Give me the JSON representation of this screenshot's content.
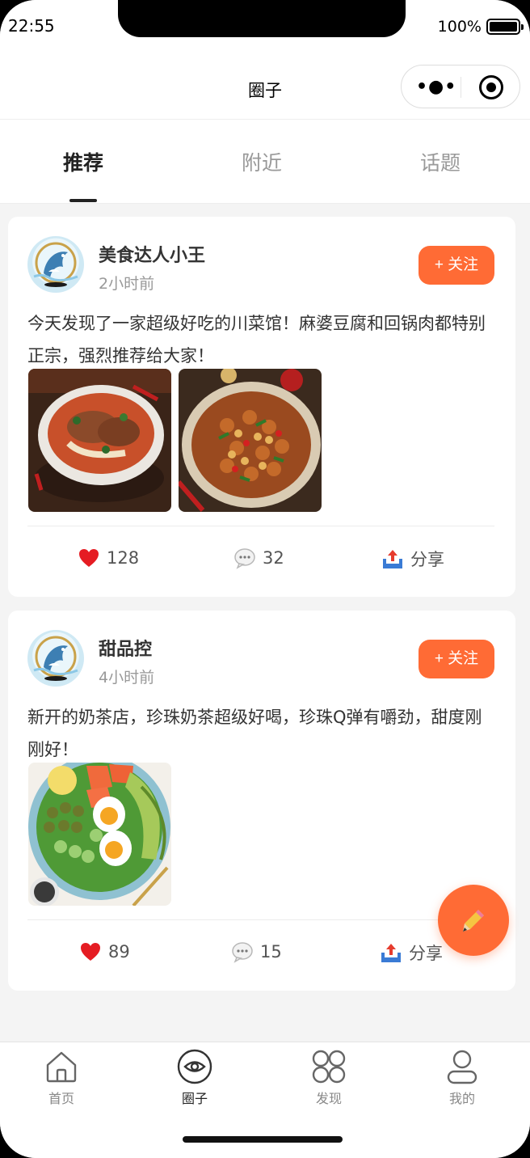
{
  "status_bar": {
    "time": "22:55",
    "battery": "100%",
    "battery_level": 1.0
  },
  "navbar": {
    "title": "圈子",
    "more_icon": "more-dots-icon",
    "target_icon": "target-icon"
  },
  "tabs": [
    {
      "label": "推荐",
      "active": true
    },
    {
      "label": "附近",
      "active": false
    },
    {
      "label": "话题",
      "active": false
    }
  ],
  "posts": [
    {
      "username": "美食达人小王",
      "time": "2小时前",
      "follow_label": "+ 关注",
      "content": "今天发现了一家超级好吃的川菜馆！麻婆豆腐和回锅肉都特别正宗，强烈推荐给大家！",
      "images": [
        "noodle-dish-photo",
        "kung-pao-chicken-photo"
      ],
      "likes": "128",
      "comments": "32",
      "share_label": "分享"
    },
    {
      "username": "甜品控",
      "time": "4小时前",
      "follow_label": "+ 关注",
      "content": "新开的奶茶店，珍珠奶茶超级好喝，珍珠Q弹有嚼劲，甜度刚刚好！",
      "images": [
        "salad-bowl-photo"
      ],
      "likes": "89",
      "comments": "15",
      "share_label": "分享"
    }
  ],
  "fab": {
    "icon": "pencil-icon"
  },
  "tabbar": [
    {
      "label": "首页",
      "icon": "home-icon",
      "active": false
    },
    {
      "label": "圈子",
      "icon": "eye-icon",
      "active": true
    },
    {
      "label": "发现",
      "icon": "grid-icon",
      "active": false
    },
    {
      "label": "我的",
      "icon": "user-icon",
      "active": false
    }
  ],
  "colors": {
    "accent": "#ff6b35",
    "background": "#f4f4f4",
    "text": "#333333",
    "muted": "#999999"
  }
}
